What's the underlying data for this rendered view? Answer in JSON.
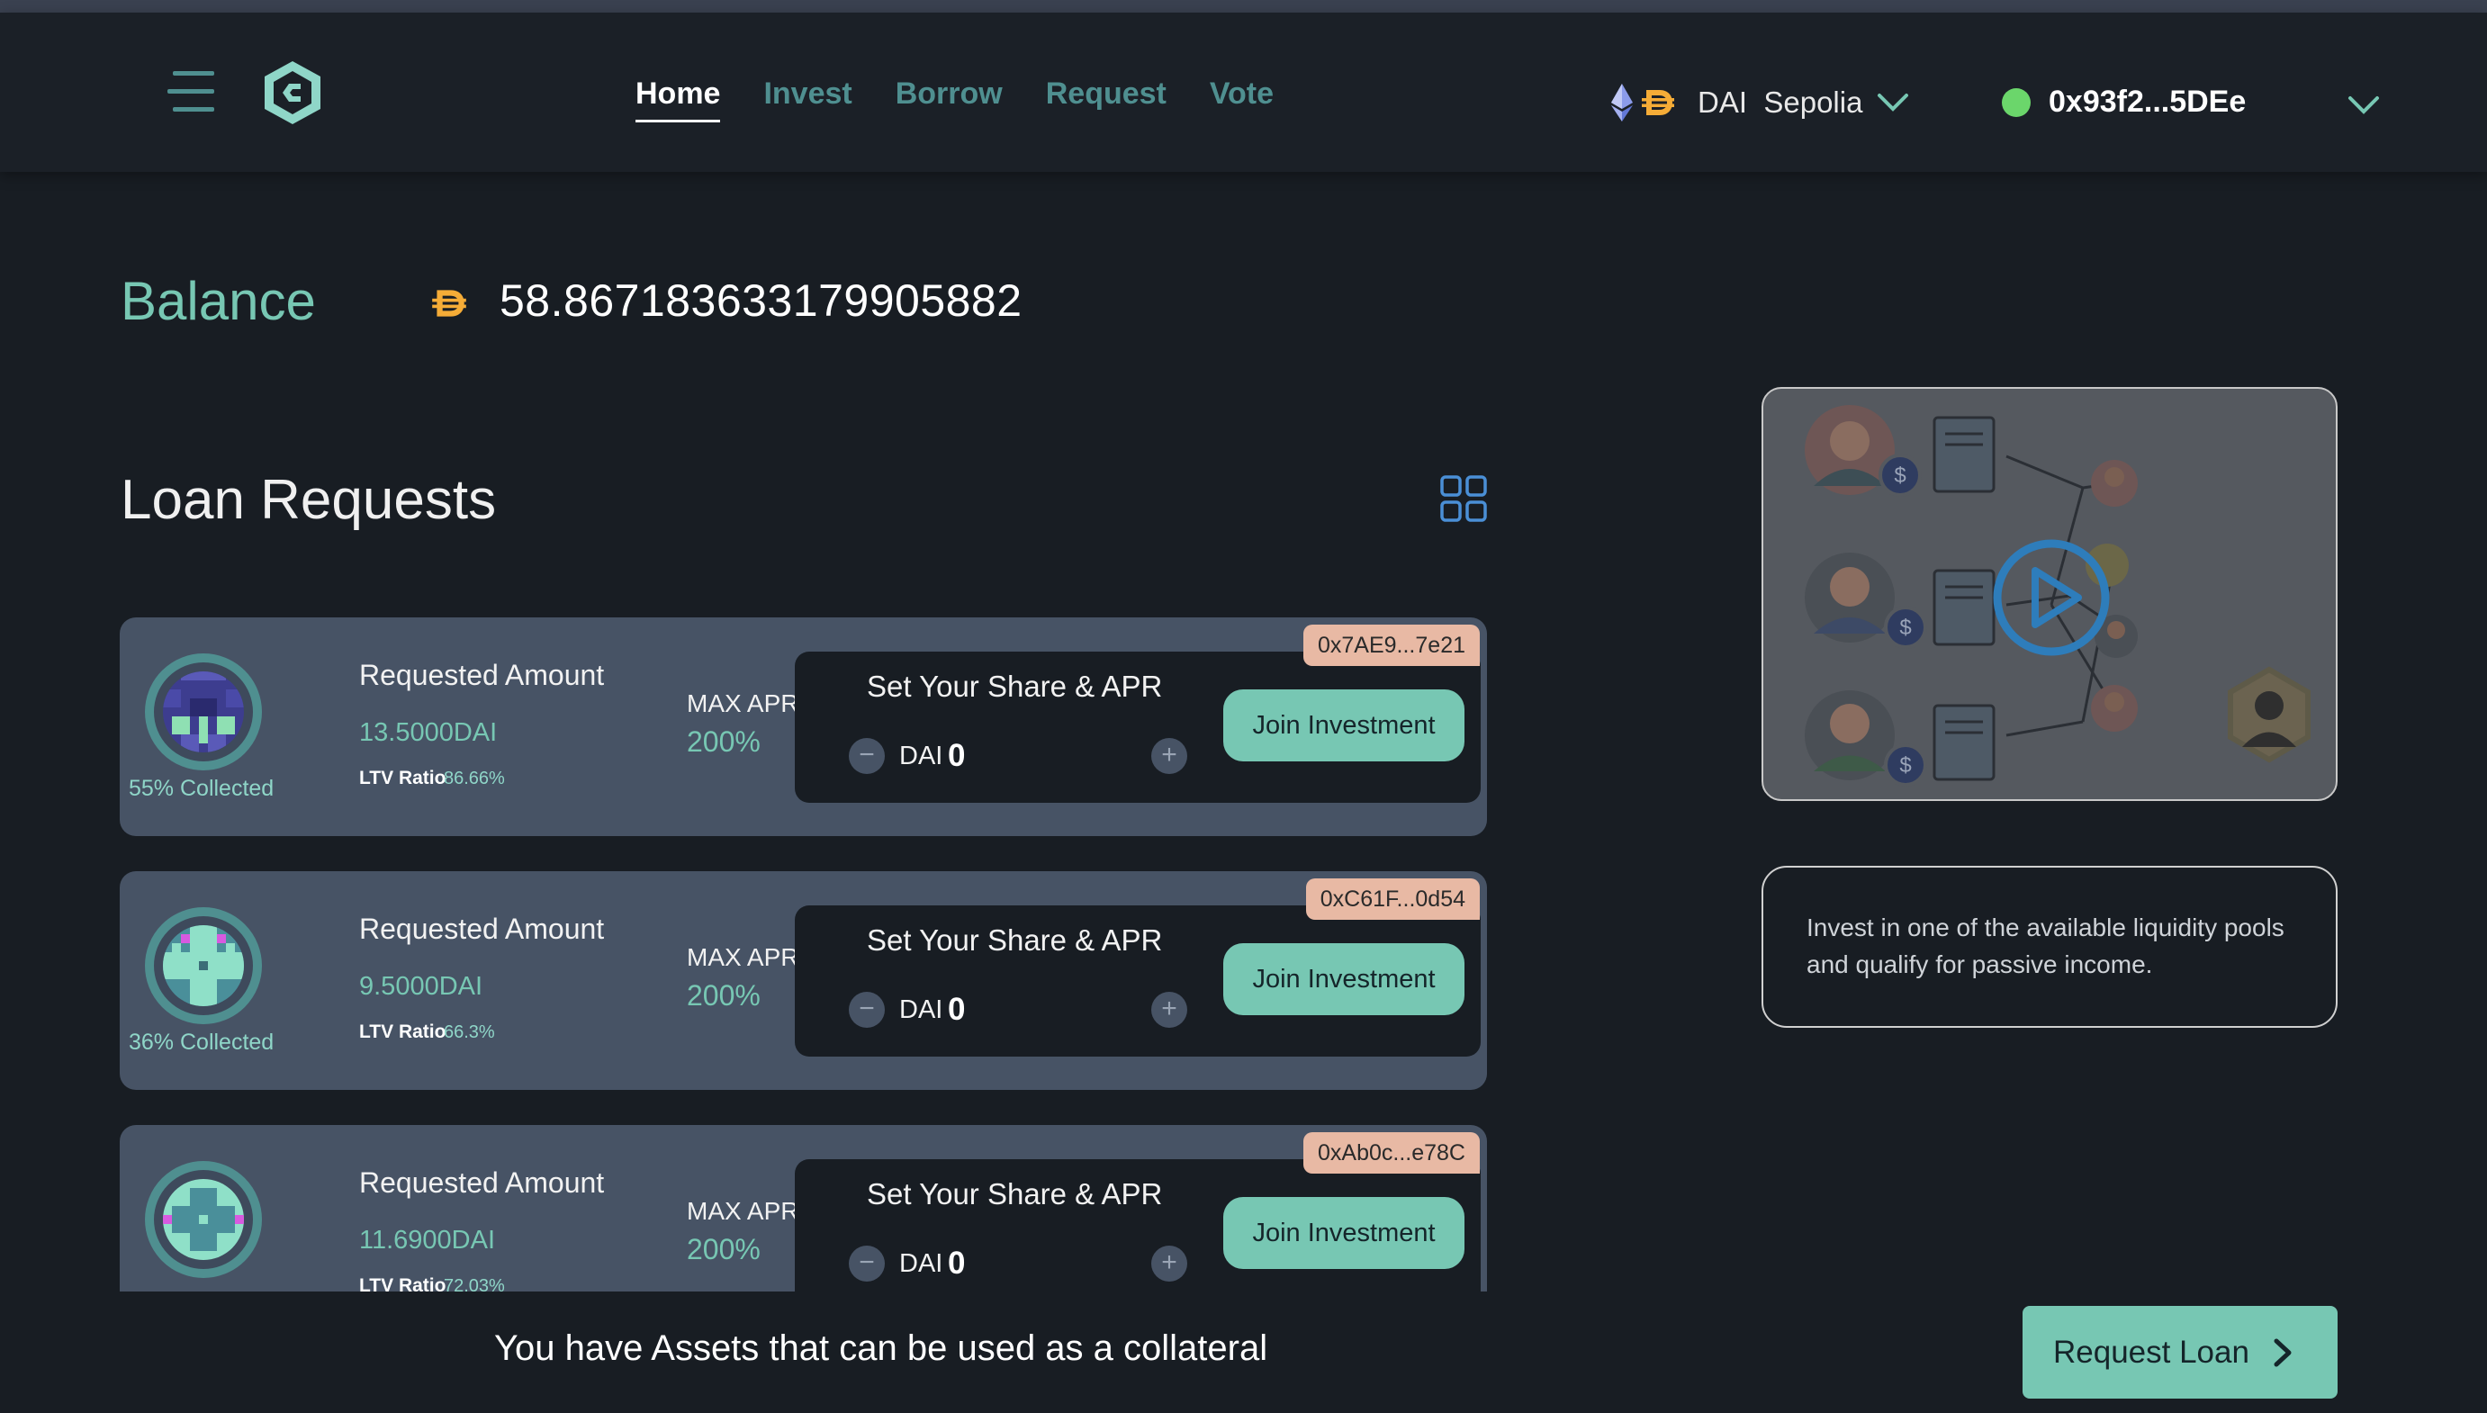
{
  "colors": {
    "background": "#181d23",
    "navbar": "#1b2027",
    "accent": "#77c7b3",
    "teal_dim": "#4f8f90",
    "card": "#475365",
    "address_tag": "#e8b9a4",
    "status_connected": "#6bd66b",
    "dai_gold": "#f5ac37"
  },
  "header": {
    "menu_icon": "hamburger-icon",
    "logo_icon": "app-logo-icon",
    "nav": [
      {
        "label": "Home",
        "active": true
      },
      {
        "label": "Invest",
        "active": false
      },
      {
        "label": "Borrow",
        "active": false
      },
      {
        "label": "Request",
        "active": false
      },
      {
        "label": "Vote",
        "active": false
      }
    ],
    "network": {
      "token": "DAI",
      "name": "Sepolia",
      "label": "DAI  Sepolia"
    },
    "wallet": {
      "address": "0x93f2...5DEe",
      "status": "connected"
    }
  },
  "balance": {
    "title": "Balance",
    "currency_icon": "dai-icon",
    "value": "58.867183633179905882"
  },
  "loan_requests": {
    "title": "Loan Requests",
    "view_toggle_icon": "grid-view-icon",
    "cards": [
      {
        "address": "0x7AE9...7e21",
        "collected_pct": 55,
        "collected_label": "55% Collected",
        "requested_label": "Requested Amount",
        "requested_amount": "13.5000DAI",
        "ltv_label": "LTV Ratio",
        "ltv_value": "86.66%",
        "apr_label": "MAX APR",
        "apr_value": "200%",
        "share_title": "Set Your Share & APR",
        "share_currency": "DAI",
        "share_amount": "0",
        "join_label": "Join Investment"
      },
      {
        "address": "0xC61F...0d54",
        "collected_pct": 36,
        "collected_label": "36% Collected",
        "requested_label": "Requested Amount",
        "requested_amount": "9.5000DAI",
        "ltv_label": "LTV Ratio",
        "ltv_value": "66.3%",
        "apr_label": "MAX APR",
        "apr_value": "200%",
        "share_title": "Set Your Share & APR",
        "share_currency": "DAI",
        "share_amount": "0",
        "join_label": "Join Investment"
      },
      {
        "address": "0xAb0c...e78C",
        "collected_pct": null,
        "collected_label": "",
        "requested_label": "Requested Amount",
        "requested_amount": "11.6900DAI",
        "ltv_label": "LTV Ratio",
        "ltv_value": "72.03%",
        "apr_label": "MAX APR",
        "apr_value": "200%",
        "share_title": "Set Your Share & APR",
        "share_currency": "DAI",
        "share_amount": "0",
        "join_label": "Join Investment"
      }
    ]
  },
  "promo": {
    "video_icon": "play-icon",
    "info_text": "Invest in one of the available liquidity pools and qualify for passive income."
  },
  "footer": {
    "collateral_text": "You have Assets that can be used as a collateral",
    "request_loan_label": "Request Loan"
  }
}
